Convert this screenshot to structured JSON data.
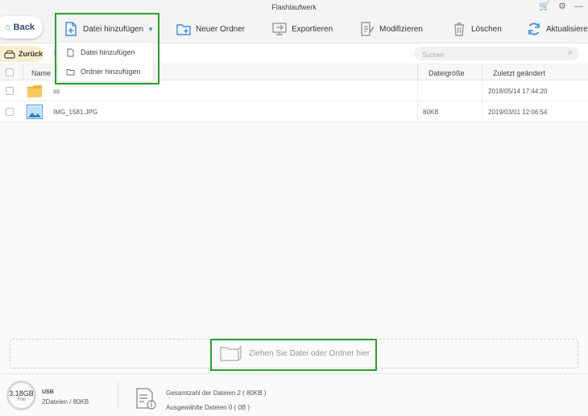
{
  "window": {
    "title": "Flashlaufwerk"
  },
  "back_button": {
    "label": "Back"
  },
  "toolbar": {
    "add_file_label": "Datei hinzufügen",
    "new_folder_label": "Neuer Ordner",
    "export_label": "Exportieren",
    "modify_label": "Modifizieren",
    "delete_label": "Löschen",
    "refresh_label": "Aktualisieren"
  },
  "dropdown": {
    "items": [
      {
        "label": "Datei hinzufügen",
        "icon": "file-icon"
      },
      {
        "label": "Ordner hinzufügen",
        "icon": "folder-icon"
      }
    ]
  },
  "nav": {
    "zuruck_label": "Zurück"
  },
  "search": {
    "placeholder": "Suchen"
  },
  "table": {
    "headers": {
      "name": "Name",
      "size": "Dateigröße",
      "modified": "Zuletzt geändert"
    },
    "rows": [
      {
        "name": "ss",
        "size": "",
        "modified": "2018/05/14 17:44:20",
        "type": "folder"
      },
      {
        "name": "IMG_1581.JPG",
        "size": "80KB",
        "modified": "2019/03/01 12:06:54",
        "type": "image"
      }
    ]
  },
  "drop_zone": {
    "text": "Ziehen Sie Datei oder Ordner hier"
  },
  "status": {
    "disk_size": "3.18GB",
    "disk_free": "Frei",
    "device": "USB",
    "files_summary": "2Dateien / 80KB",
    "total_files": "Gesamtzahl der Dateien  2  ( 80KB )",
    "selected_files": "Ausgewählte Dateien  0  ( 0B )"
  },
  "colors": {
    "accent": "#3a8fd8",
    "highlight": "#2aa02a",
    "back_bg": "#fbeed0"
  }
}
